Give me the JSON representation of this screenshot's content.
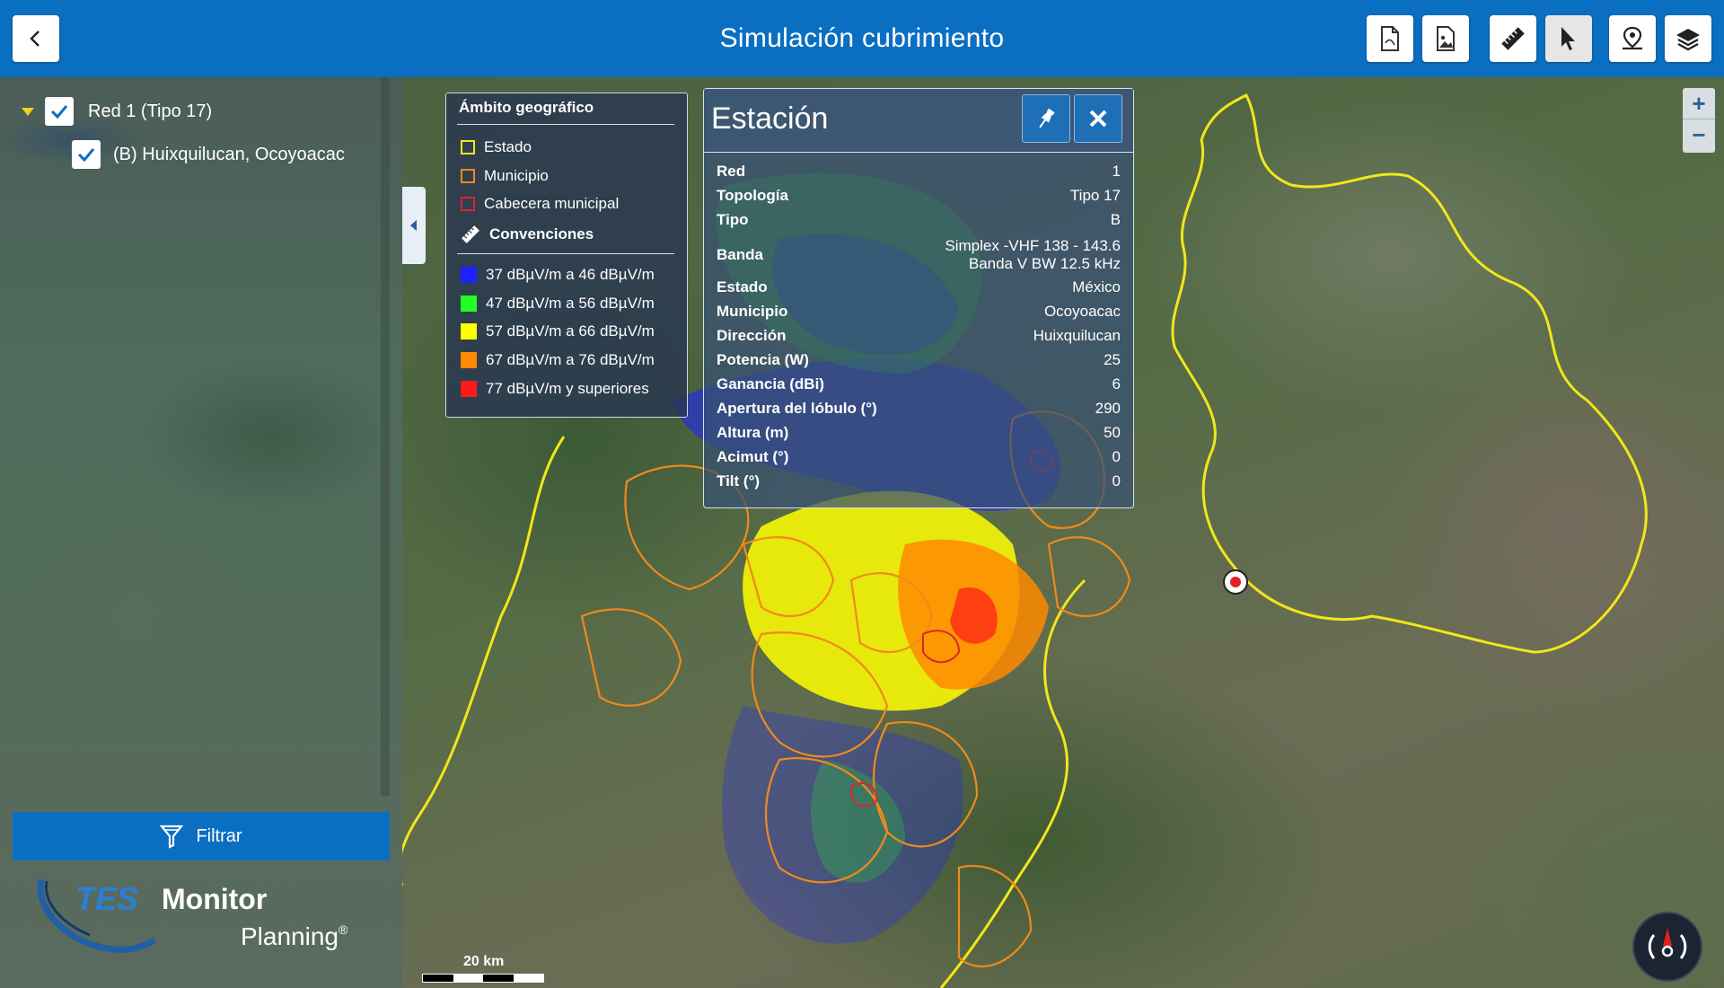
{
  "header": {
    "title": "Simulación cubrimiento",
    "toolbar": [
      {
        "name": "export-pdf-button",
        "icon": "pdf-file-icon"
      },
      {
        "name": "export-image-button",
        "icon": "image-file-icon"
      },
      {
        "name": "measure-button",
        "icon": "ruler-icon"
      },
      {
        "name": "select-button",
        "icon": "cursor-icon",
        "active": true
      },
      {
        "name": "location-button",
        "icon": "map-pin-icon"
      },
      {
        "name": "layers-button",
        "icon": "layers-icon"
      }
    ]
  },
  "sidebar": {
    "tree": [
      {
        "label": "Red 1 (Tipo 17)",
        "checked": true,
        "expanded": true
      },
      {
        "label": "(B) Huixquilucan, Ocoyoacac",
        "checked": true
      }
    ],
    "filter_label": "Filtrar",
    "logo": {
      "tes": "TES",
      "monitor": "Monitor",
      "planning": "Planning",
      "reg": "®"
    }
  },
  "legend": {
    "geo_title": "Ámbito geográfico",
    "geo_items": [
      {
        "label": "Estado",
        "color": "#f2e61a"
      },
      {
        "label": "Municipio",
        "color": "#f08a1a"
      },
      {
        "label": "Cabecera municipal",
        "color": "#d9262a"
      }
    ],
    "conv_title": "Convenciones",
    "conv_items": [
      {
        "label": "37 dBµV/m a 46 dBµV/m",
        "color": "#1a22ff"
      },
      {
        "label": "47 dBµV/m a 56 dBµV/m",
        "color": "#22ff22"
      },
      {
        "label": "57 dBµV/m a 66 dBµV/m",
        "color": "#ffff00"
      },
      {
        "label": "67 dBµV/m a 76 dBµV/m",
        "color": "#ff8a00"
      },
      {
        "label": "77 dBµV/m y superiores",
        "color": "#ff1a1a"
      }
    ]
  },
  "station": {
    "title": "Estación",
    "rows": [
      {
        "k": "Red",
        "v": "1"
      },
      {
        "k": "Topología",
        "v": "Tipo 17"
      },
      {
        "k": "Tipo",
        "v": "B"
      },
      {
        "k": "Banda",
        "v": "Simplex -VHF 138 - 143.6",
        "v2": "Banda V BW 12.5 kHz"
      },
      {
        "k": "Estado",
        "v": "México"
      },
      {
        "k": "Municipio",
        "v": "Ocoyoacac"
      },
      {
        "k": "Dirección",
        "v": "Huixquilucan"
      },
      {
        "k": "Potencia (W)",
        "v": "25"
      },
      {
        "k": "Ganancia (dBi)",
        "v": "6"
      },
      {
        "k": "Apertura del lóbulo (°)",
        "v": "290"
      },
      {
        "k": "Altura (m)",
        "v": "50"
      },
      {
        "k": "Acimut (°)",
        "v": "0"
      },
      {
        "k": "Tilt (°)",
        "v": "0"
      }
    ]
  },
  "map": {
    "zoom_in": "+",
    "zoom_out": "−",
    "scale_label": "20 km"
  }
}
